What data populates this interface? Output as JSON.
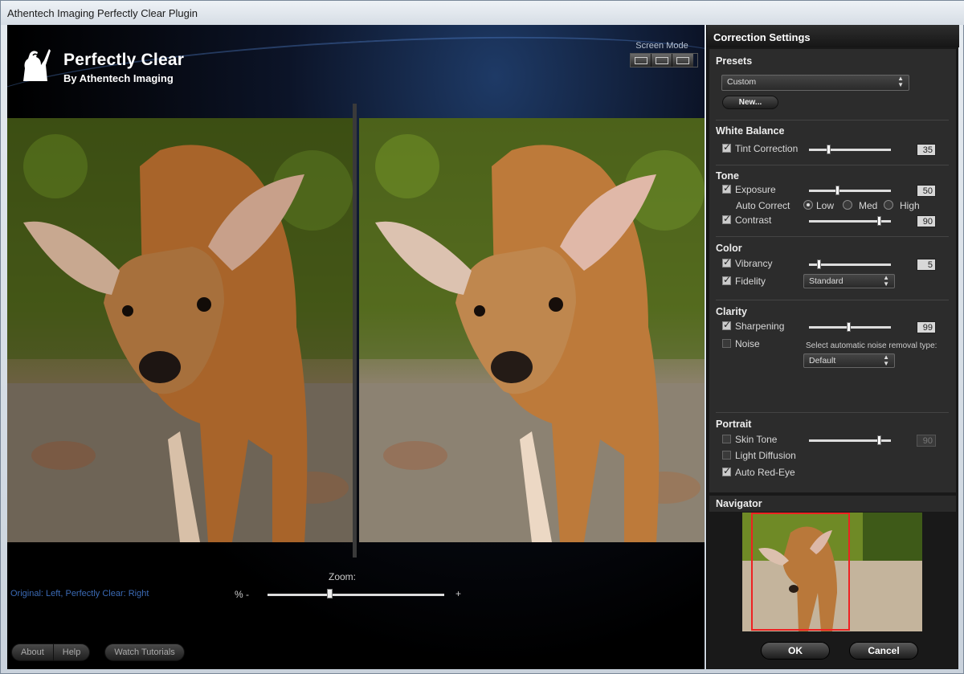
{
  "window": {
    "title": "Athentech Imaging Perfectly Clear Plugin"
  },
  "brand": {
    "name": "Perfectly Clear",
    "subtitle": "By Athentech Imaging"
  },
  "screen_mode": {
    "label": "Screen Mode"
  },
  "viewer": {
    "zoom_label": "Zoom:",
    "compare_label": "Original: Left, Perfectly Clear: Right",
    "zoom_minus": "% -",
    "zoom_plus": "+",
    "zoom_level": 0.35
  },
  "bottom_buttons": {
    "about": "About",
    "help": "Help",
    "tutorials": "Watch Tutorials"
  },
  "panel": {
    "title": "Correction Settings",
    "presets": {
      "title": "Presets",
      "selected": "Custom",
      "new_button": "New..."
    },
    "white_balance": {
      "title": "White Balance",
      "tint": {
        "label": "Tint Correction",
        "checked": true,
        "value": "35"
      }
    },
    "tone": {
      "title": "Tone",
      "exposure": {
        "label": "Exposure",
        "checked": true,
        "value": "50"
      },
      "auto_correct": {
        "label": "Auto Correct",
        "options": [
          "Low",
          "Med",
          "High"
        ],
        "selected": "Low"
      },
      "contrast": {
        "label": "Contrast",
        "checked": true,
        "value": "90"
      }
    },
    "color": {
      "title": "Color",
      "vibrancy": {
        "label": "Vibrancy",
        "checked": true,
        "value": "5"
      },
      "fidelity": {
        "label": "Fidelity",
        "checked": true,
        "selected": "Standard"
      }
    },
    "clarity": {
      "title": "Clarity",
      "sharpening": {
        "label": "Sharpening",
        "checked": true,
        "value": "99"
      },
      "noise": {
        "label": "Noise",
        "checked": false,
        "hint": "Select automatic noise removal type:",
        "selected": "Default"
      }
    },
    "portrait": {
      "title": "Portrait",
      "skin_tone": {
        "label": "Skin Tone",
        "checked": false,
        "value": "90"
      },
      "light_diffusion": {
        "label": "Light Diffusion",
        "checked": false
      },
      "auto_red_eye": {
        "label": "Auto Red-Eye",
        "checked": true
      }
    },
    "navigator": {
      "title": "Navigator"
    },
    "ok_button": "OK",
    "cancel_button": "Cancel"
  }
}
